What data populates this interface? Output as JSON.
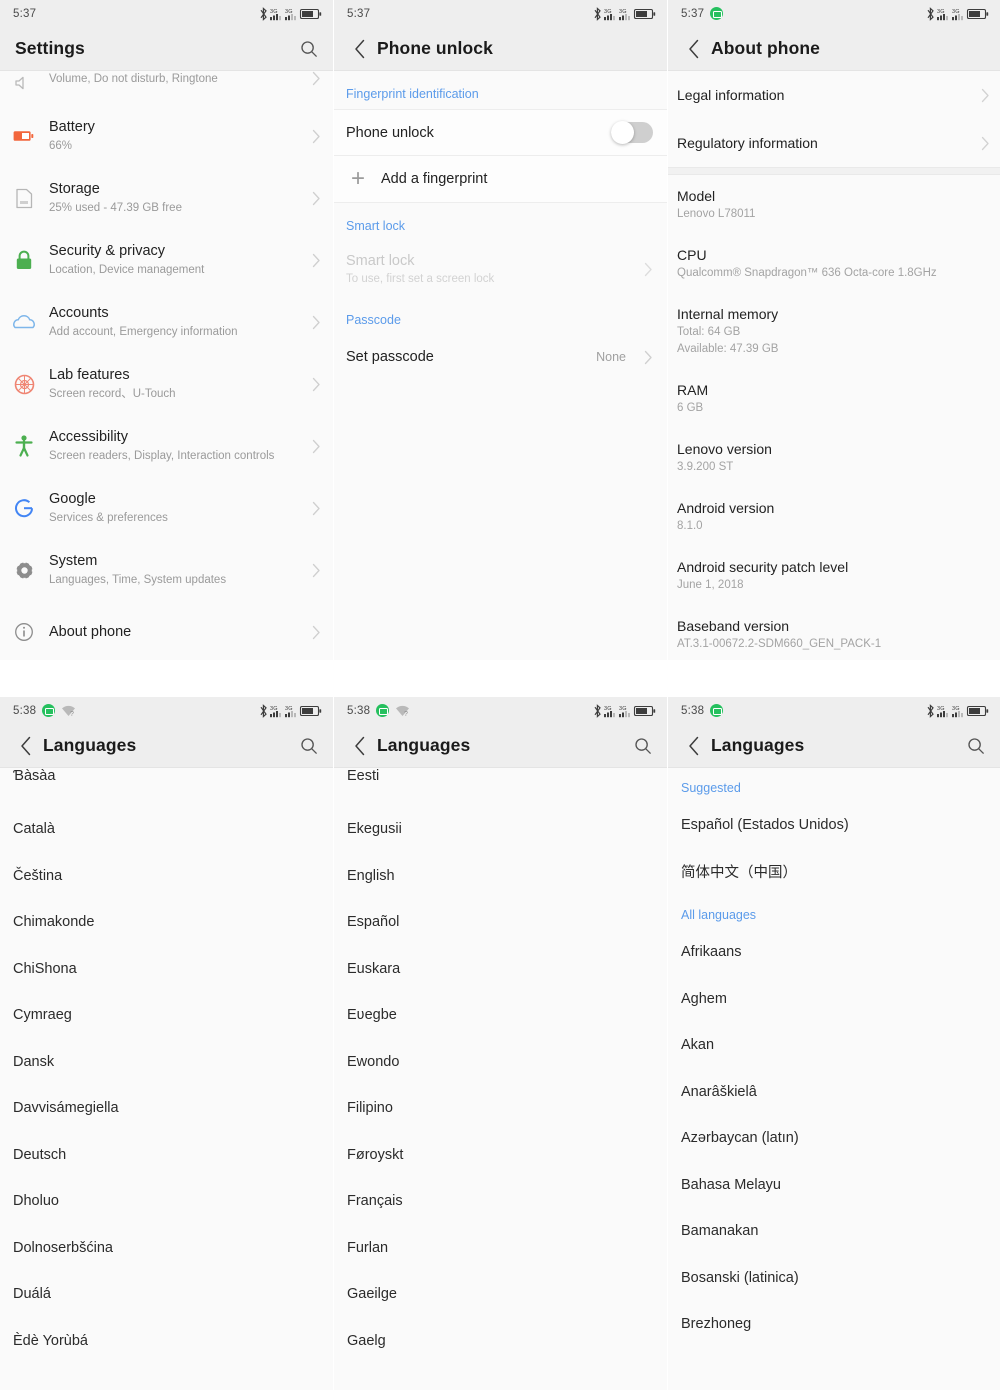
{
  "panels": {
    "settings": {
      "statusbar": {
        "time": "5:37"
      },
      "title": "Settings",
      "search_icon": "search-icon",
      "partial_item": {
        "subtitle": "Volume, Do not disturb, Ringtone"
      },
      "items": [
        {
          "icon": "battery-icon",
          "title": "Battery",
          "subtitle": "66%"
        },
        {
          "icon": "sdcard-icon",
          "title": "Storage",
          "subtitle": "25% used - 47.39 GB free"
        },
        {
          "icon": "lock-icon",
          "title": "Security & privacy",
          "subtitle": "Location, Device management"
        },
        {
          "icon": "cloud-icon",
          "title": "Accounts",
          "subtitle": "Add account, Emergency information"
        },
        {
          "icon": "lab-flask-icon",
          "title": "Lab features",
          "subtitle": "Screen record、U-Touch"
        },
        {
          "icon": "accessibility-icon",
          "title": "Accessibility",
          "subtitle": "Screen readers, Display, Interaction controls"
        },
        {
          "icon": "google-g-icon",
          "title": "Google",
          "subtitle": "Services & preferences"
        },
        {
          "icon": "gear-icon",
          "title": "System",
          "subtitle": "Languages, Time, System updates"
        },
        {
          "icon": "info-icon",
          "title": "About phone",
          "subtitle": ""
        }
      ]
    },
    "phone_unlock": {
      "statusbar": {
        "time": "5:37"
      },
      "title": "Phone unlock",
      "section_fingerprint": "Fingerprint identification",
      "toggle_label": "Phone unlock",
      "toggle_state": "off",
      "add_fingerprint": "Add a fingerprint",
      "section_smartlock": "Smart lock",
      "smartlock_title": "Smart lock",
      "smartlock_subtitle": "To use, first set a screen lock",
      "section_passcode": "Passcode",
      "set_passcode_label": "Set passcode",
      "set_passcode_value": "None"
    },
    "about_phone": {
      "statusbar": {
        "time": "5:37"
      },
      "title": "About phone",
      "links": [
        {
          "label": "Legal information"
        },
        {
          "label": "Regulatory information"
        }
      ],
      "info": [
        {
          "key": "Model",
          "value": "Lenovo L78011"
        },
        {
          "key": "CPU",
          "value": "Qualcomm® Snapdragon™ 636 Octa-core 1.8GHz"
        },
        {
          "key": "Internal memory",
          "value": "Total: 64 GB\nAvailable: 47.39 GB"
        },
        {
          "key": "RAM",
          "value": "6 GB"
        },
        {
          "key": "Lenovo version",
          "value": "3.9.200 ST"
        },
        {
          "key": "Android version",
          "value": "8.1.0"
        },
        {
          "key": "Android security patch level",
          "value": "June 1, 2018"
        },
        {
          "key": "Baseband version",
          "value": "AT.3.1-00672.2-SDM660_GEN_PACK-1"
        }
      ]
    },
    "languages_a": {
      "statusbar": {
        "time": "5:38"
      },
      "title": "Languages",
      "items": [
        "Ɓàsàa",
        "Català",
        "Čeština",
        "Chimakonde",
        "ChiShona",
        "Cymraeg",
        "Dansk",
        "Davvisámegiella",
        "Deutsch",
        "Dholuo",
        "Dolnoserbšćina",
        "Duálá",
        "Èdè Yorùbá"
      ]
    },
    "languages_b": {
      "statusbar": {
        "time": "5:38"
      },
      "title": "Languages",
      "items": [
        "Eesti",
        "Ekegusii",
        "English",
        "Español",
        "Euskara",
        "Eʋegbe",
        "Ewondo",
        "Filipino",
        "Føroyskt",
        "Français",
        "Furlan",
        "Gaeilge",
        "Gaelg"
      ]
    },
    "languages_c": {
      "statusbar": {
        "time": "5:38"
      },
      "title": "Languages",
      "section_suggested": "Suggested",
      "suggested": [
        "Español (Estados Unidos)",
        "简体中文（中国）"
      ],
      "section_all": "All languages",
      "all": [
        "Afrikaans",
        "Aghem",
        "Akan",
        "Anarâškielâ",
        "Azərbaycan (latın)",
        "Bahasa Melayu",
        "Bamanakan",
        "Bosanski (latinica)",
        "Brezhoneg"
      ]
    }
  },
  "colors": {
    "accent_blue": "#5b9bea",
    "battery_orange": "#f2663c",
    "lock_green": "#4caf50",
    "cloud_blue": "#7eb6ea",
    "lab_red": "#ef8573",
    "accessibility_green": "#4caf50",
    "google_blue": "#4285f4",
    "status_green": "#25c05e",
    "header_bg": "#eeeeee",
    "page_bg": "#fafafa"
  }
}
